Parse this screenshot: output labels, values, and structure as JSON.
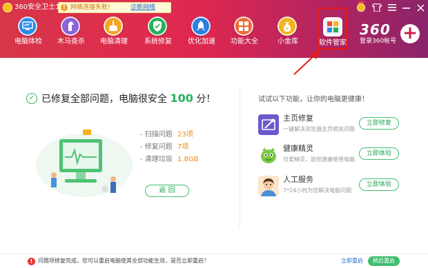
{
  "titlebar": {
    "app_title": "360安全卫士11",
    "net_warning": "网络连接失败!",
    "diagnose_link": "诊断网络",
    "icons": [
      "medal-icon",
      "skin-icon",
      "menu-icon",
      "minimize-icon",
      "close-icon"
    ]
  },
  "toolbar": {
    "items": [
      {
        "label": "电脑体检",
        "icon": "monitor-icon",
        "color": "#2e8ae6"
      },
      {
        "label": "木马查杀",
        "icon": "horse-icon",
        "color": "#8b62d9"
      },
      {
        "label": "电脑清理",
        "icon": "broom-icon",
        "color": "#f5a623"
      },
      {
        "label": "系统修复",
        "icon": "shield-icon",
        "color": "#26b05b"
      },
      {
        "label": "优化加速",
        "icon": "rocket-icon",
        "color": "#2f7fe0"
      },
      {
        "label": "功能大全",
        "icon": "grid-icon",
        "color": "#ef6b3a"
      },
      {
        "label": "小金库",
        "icon": "coin-bag-icon",
        "color": "#f5b21d"
      },
      {
        "label": "软件管家",
        "icon": "software-manager-icon",
        "color": "#f3f3f3"
      }
    ],
    "brand_logo": "360",
    "account_label": "登录360帐号"
  },
  "status": {
    "prefix": "已修复全部问题，电脑很安全",
    "score": "100",
    "suffix": "分！"
  },
  "stats": [
    {
      "label": "- 扫描问题",
      "value": "23项"
    },
    {
      "label": "- 修复问题",
      "value": "7项"
    },
    {
      "label": "- 清理垃圾",
      "value": "1.8GB"
    }
  ],
  "back_button": "返 回",
  "recommend": {
    "title": "试试以下功能，让你的电脑更健康！",
    "features": [
      {
        "name": "主页修复",
        "desc": "一键解决浏览器主页相关问题",
        "button": "立即修复",
        "icon": "homepage-repair-icon",
        "color": "#6a5acd"
      },
      {
        "name": "健康精灵",
        "desc": "可爱精灵，助您健康使用电脑",
        "button": "立即体验",
        "icon": "health-sprite-icon",
        "color": "#7ac943"
      },
      {
        "name": "人工服务",
        "desc": "7*24小时为您解决电脑问题",
        "button": "立即体验",
        "icon": "customer-service-icon",
        "color": "#f0a04b"
      }
    ]
  },
  "bottom": {
    "notice": "问题项修复完成，您可以重启电脑使其全部功能生效，是否立即重启？",
    "restart_later": "立即重启",
    "restart_now": "稍后重启"
  }
}
